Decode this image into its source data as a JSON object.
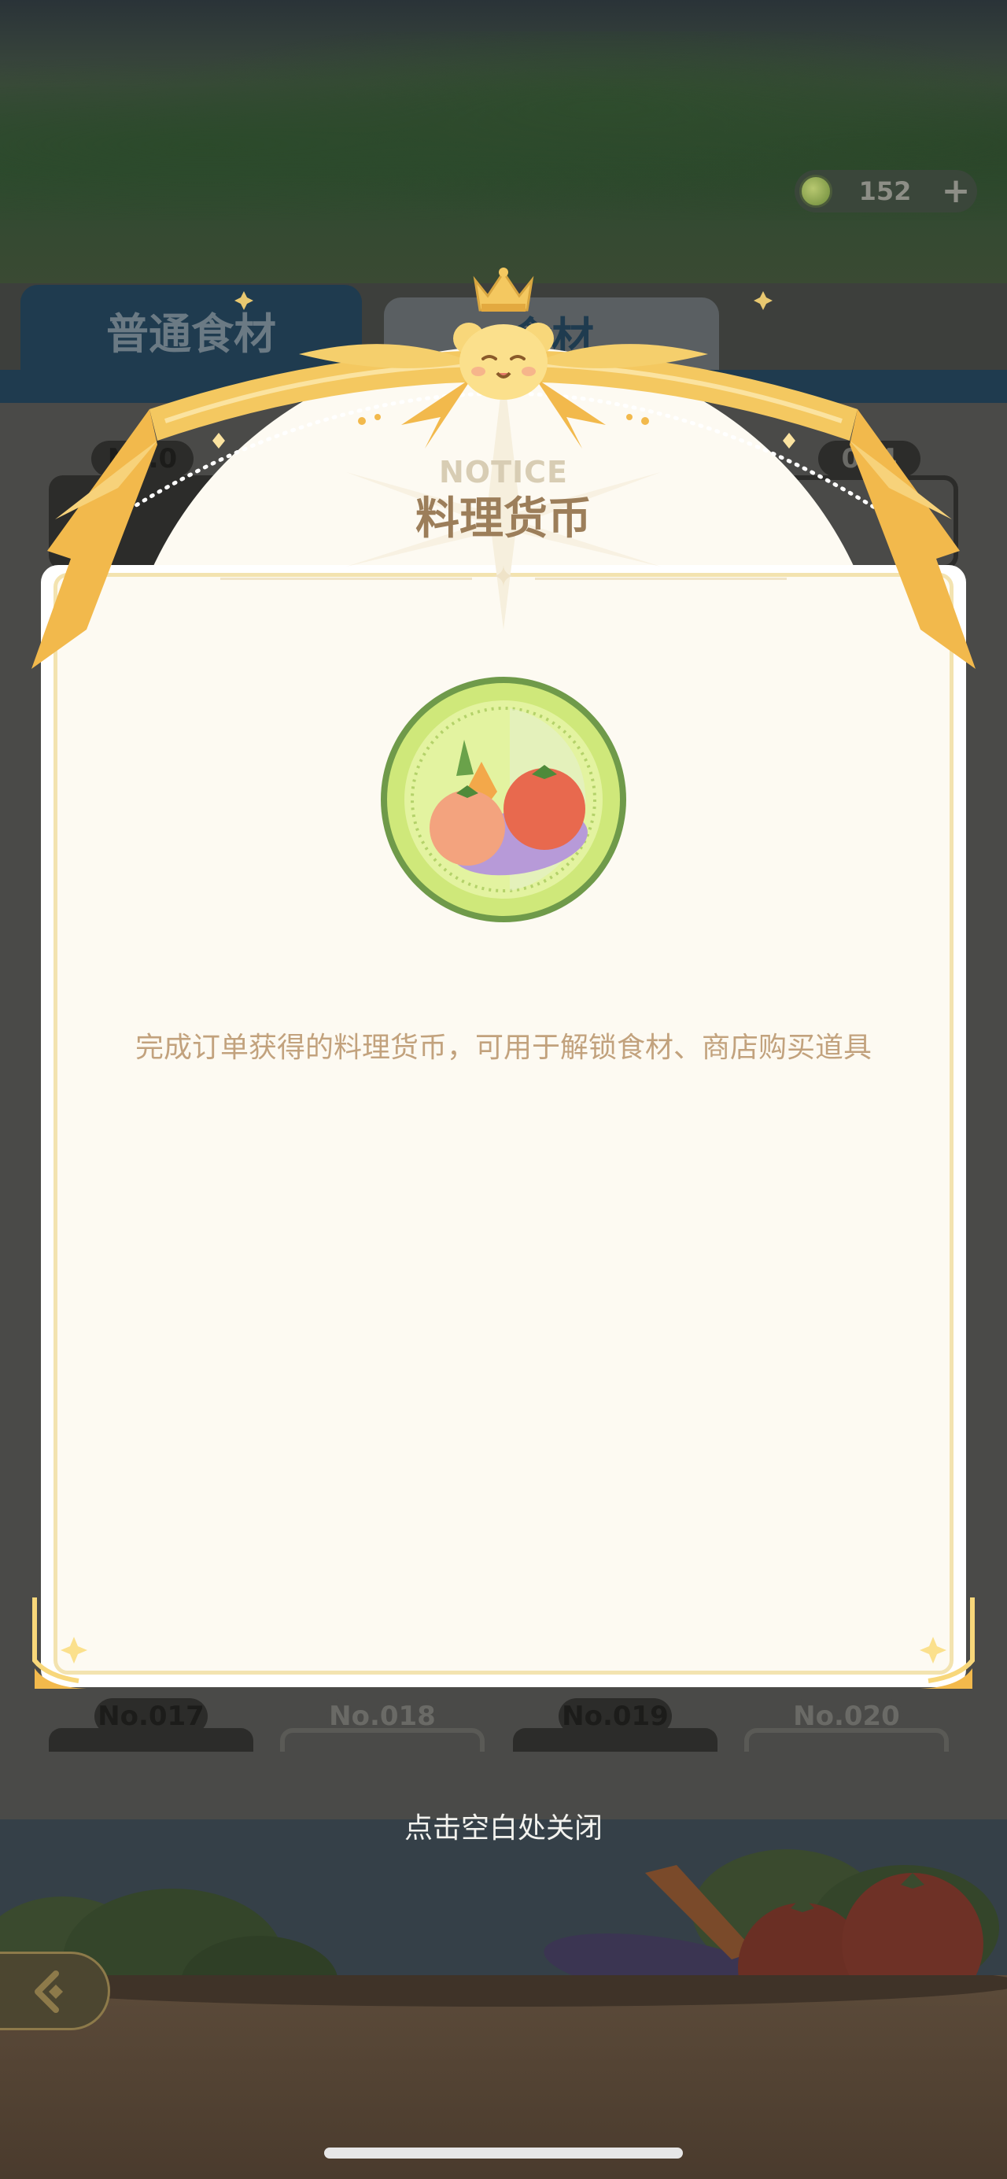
{
  "currency": {
    "value": "152",
    "plus_label": "+"
  },
  "tabs": [
    {
      "label": "普通食材"
    },
    {
      "label": "食材"
    }
  ],
  "bg_cards_top": [
    {
      "label": "No.0"
    },
    {
      "label": "004"
    }
  ],
  "bg_cards_bottom": [
    {
      "label": "No.017"
    },
    {
      "label": "No.018"
    },
    {
      "label": "No.019"
    },
    {
      "label": "No.020"
    }
  ],
  "modal": {
    "notice": "NOTICE",
    "title": "料理货币",
    "description": "完成订单获得的料理货币，可用于解锁食材、商店购买道具"
  },
  "close_hint": "点击空白处关闭",
  "colors": {
    "modal_bg": "#fdfaf2",
    "ribbon_gold": "#f4c860",
    "title_brown": "#9c7e5a",
    "description_tan": "#c2a27d",
    "tab_navy": "#1f3b4f"
  },
  "icons": {
    "currency": "vegetable-coin-icon",
    "back": "back-arrow-icon",
    "mascot": "bear-mascot-icon",
    "crown": "crown-icon"
  }
}
